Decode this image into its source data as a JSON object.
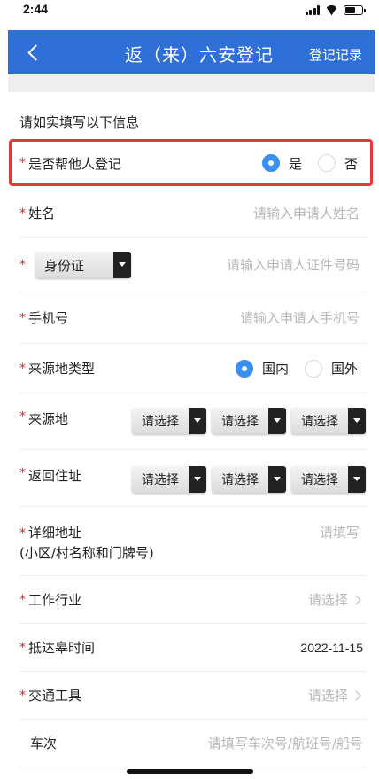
{
  "status": {
    "time": "2:44"
  },
  "nav": {
    "title": "返（来）六安登记",
    "record_label": "登记记录"
  },
  "form": {
    "hint": "请如实填写以下信息",
    "required_mark": "*",
    "help_other": {
      "label": "是否帮他人登记",
      "options": [
        "是",
        "否"
      ],
      "selected": "是"
    },
    "name": {
      "label": "姓名",
      "placeholder": "请输入申请人姓名"
    },
    "id_doc": {
      "type_value": "身份证",
      "placeholder": "请输入申请人证件号码"
    },
    "phone": {
      "label": "手机号",
      "placeholder": "请输入申请人手机号"
    },
    "origin_type": {
      "label": "来源地类型",
      "options": [
        "国内",
        "国外"
      ],
      "selected": "国内"
    },
    "origin": {
      "label": "来源地",
      "selects": [
        "请选择",
        "请选择",
        "请选择"
      ]
    },
    "return_address": {
      "label": "返回住址",
      "selects": [
        "请选择",
        "请选择",
        "请选择"
      ]
    },
    "detail_address": {
      "label": "详细地址",
      "sublabel": "(小区/村名称和门牌号)",
      "placeholder": "请填写"
    },
    "industry": {
      "label": "工作行业",
      "placeholder": "请选择"
    },
    "arrival_time": {
      "label": "抵达皋时间",
      "value": "2022-11-15"
    },
    "transport": {
      "label": "交通工具",
      "placeholder": "请选择"
    },
    "trip_no": {
      "label": "车次",
      "placeholder": "请填写车次号/航班号/船号"
    }
  },
  "colors": {
    "accent": "#2f6fd8",
    "radio": "#3b8ff0",
    "required": "#e02020",
    "highlight": "#e53935"
  }
}
